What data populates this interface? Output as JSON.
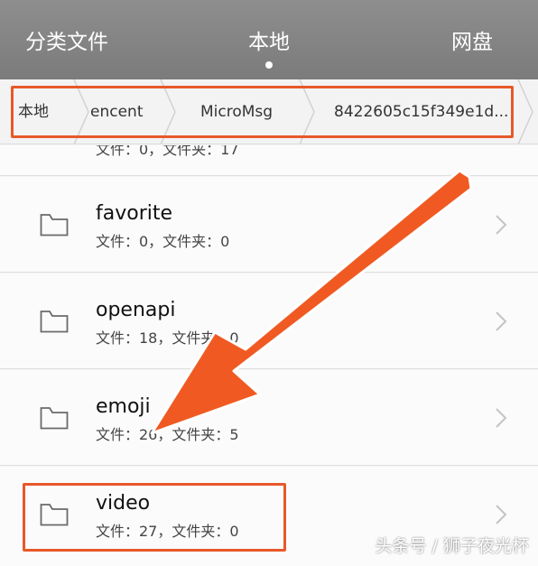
{
  "tabs": {
    "left": "分类文件",
    "center": "本地",
    "right": "网盘"
  },
  "breadcrumb": {
    "items": [
      "本地",
      "encent",
      "MicroMsg",
      "8422605c15f349e1d..."
    ]
  },
  "partial_row": {
    "meta": "文件：0，文件夹：17"
  },
  "folders": [
    {
      "name": "favorite",
      "meta": "文件：0，文件夹：0"
    },
    {
      "name": "openapi",
      "meta": "文件：18，文件夹：0"
    },
    {
      "name": "emoji",
      "meta": "文件：26，文件夹：5"
    },
    {
      "name": "video",
      "meta": "文件：27，文件夹：0"
    }
  ],
  "annotations": {
    "highlight_color": "#e8582a"
  },
  "watermark": "头条号 / 狮子夜光杯"
}
